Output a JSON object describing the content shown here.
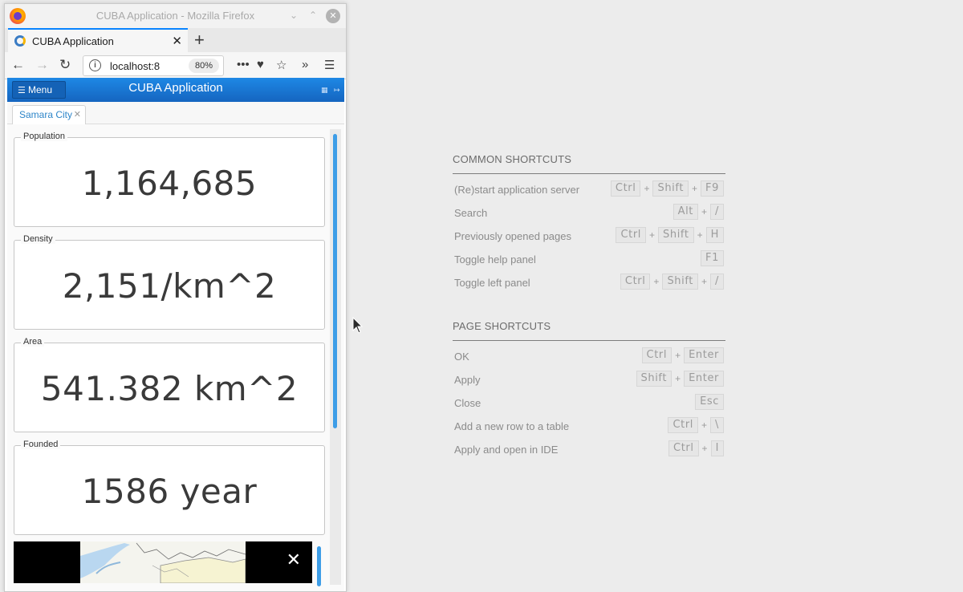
{
  "browser": {
    "window_title": "CUBA Application - Mozilla Firefox",
    "tab_title": "CUBA Application",
    "url": "localhost:8",
    "zoom": "80%"
  },
  "app": {
    "menu_label": "Menu",
    "title": "CUBA Application",
    "open_tab": "Samara City"
  },
  "city": {
    "population_caption": "Population",
    "population_value": "1,164,685",
    "density_caption": "Density",
    "density_value": "2,151/km^2",
    "area_caption": "Area",
    "area_value": "541.382 km^2",
    "founded_caption": "Founded",
    "founded_value": "1586 year"
  },
  "shortcuts": {
    "common_title": "COMMON SHORTCUTS",
    "common": [
      {
        "label": "(Re)start application server",
        "keys": [
          "Ctrl",
          "Shift",
          "F9"
        ]
      },
      {
        "label": "Search",
        "keys": [
          "Alt",
          "/"
        ]
      },
      {
        "label": "Previously opened pages",
        "keys": [
          "Ctrl",
          "Shift",
          "H"
        ]
      },
      {
        "label": "Toggle help panel",
        "keys": [
          "F1"
        ]
      },
      {
        "label": "Toggle left panel",
        "keys": [
          "Ctrl",
          "Shift",
          "/"
        ]
      }
    ],
    "page_title": "PAGE SHORTCUTS",
    "page": [
      {
        "label": "OK",
        "keys": [
          "Ctrl",
          "Enter"
        ]
      },
      {
        "label": "Apply",
        "keys": [
          "Shift",
          "Enter"
        ]
      },
      {
        "label": "Close",
        "keys": [
          "Esc"
        ]
      },
      {
        "label": "Add a new row to a table",
        "keys": [
          "Ctrl",
          "\\"
        ]
      },
      {
        "label": "Apply and open in IDE",
        "keys": [
          "Ctrl",
          "I"
        ]
      }
    ]
  },
  "icons": {
    "firefox": "firefox-logo-icon",
    "back": "arrow-left-icon",
    "forward": "arrow-right-icon",
    "reload": "reload-icon",
    "info": "info-icon",
    "more": "more-dots-icon",
    "pocket": "pocket-icon",
    "bookmark": "star-icon",
    "overflow": "chevrons-right-icon",
    "hamburger": "hamburger-menu-icon"
  }
}
